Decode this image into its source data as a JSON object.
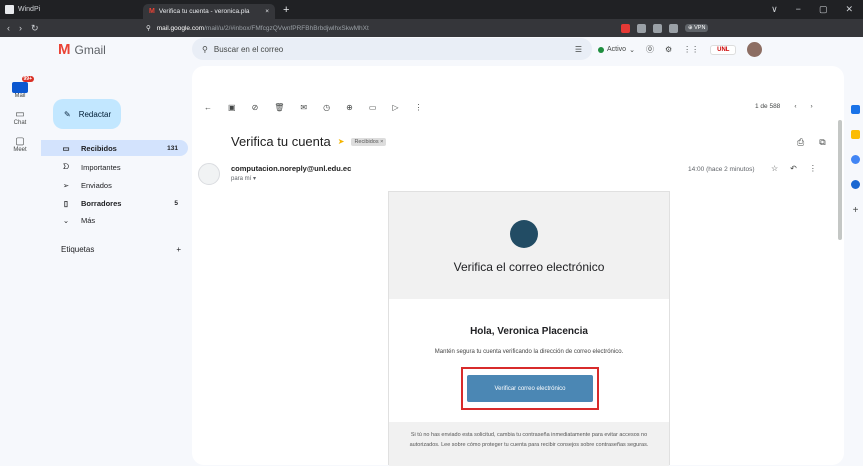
{
  "window": {
    "app": "WindPi",
    "tab_title": "Verifica tu cuenta - veronica.pla",
    "close": "×",
    "newtab": "+",
    "controls": [
      "∨",
      "−",
      "▢",
      "✕"
    ]
  },
  "address": {
    "host": "mail.google.com",
    "path": "/mail/u/2/#inbox/FMfcgzQVwnfPRFBhBrbdjwlhxSkwMhXt",
    "nav": [
      "‹",
      "›",
      "↻"
    ],
    "vpn": "⊕ VPN"
  },
  "gmail": {
    "brand": "Gmail",
    "search_placeholder": "Buscar en el correo",
    "status": "Activo",
    "uni": "UNL"
  },
  "rail": [
    {
      "label": "Mail",
      "badge": "99+"
    },
    {
      "label": "Chat"
    },
    {
      "label": "Meet"
    }
  ],
  "sidebar": {
    "compose": "Redactar",
    "items": [
      {
        "label": "Recibidos",
        "count": "131",
        "icon": "▭"
      },
      {
        "label": "Importantes",
        "count": "",
        "icon": "ᗤ"
      },
      {
        "label": "Enviados",
        "count": "",
        "icon": "➢"
      },
      {
        "label": "Borradores",
        "count": "5",
        "icon": "▯"
      },
      {
        "label": "Más",
        "count": "",
        "icon": "⌄"
      }
    ],
    "labels_title": "Etiquetas",
    "labels_add": "+"
  },
  "toolbar": {
    "pagination": "1 de 588"
  },
  "message": {
    "subject": "Verifica tu cuenta",
    "label_chip": "Recibidos ×",
    "sender": "computacion.noreply@unl.edu.ec",
    "to": "para mí ▾",
    "time": "14:00 (hace 2 minutos)"
  },
  "email_body": {
    "headline": "Verifica el correo electrónico",
    "greeting": "Hola, Veronica Placencia",
    "description": "Mantén segura tu cuenta verificando la dirección de correo electrónico.",
    "button": "Verificar correo electrónico",
    "footer": "Si tú no has enviado esta solicitud, cambia tu contraseña inmediatamente para evitar accesos no autorizados. Lee sobre cómo proteger tu cuenta para recibir consejos sobre contraseñas seguras."
  },
  "colors": {
    "accent": "#0b57d0",
    "button": "#4b87b4",
    "highlight": "#d82b2b"
  }
}
